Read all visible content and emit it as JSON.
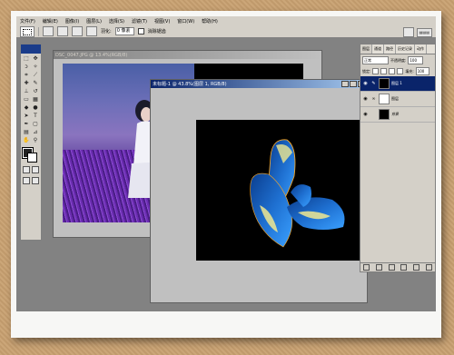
{
  "menubar": {
    "items": [
      "文件(F)",
      "编辑(E)",
      "图像(I)",
      "图层(L)",
      "选择(S)",
      "滤镜(T)",
      "视图(V)",
      "窗口(W)",
      "帮助(H)"
    ]
  },
  "options": {
    "feather_label": "羽化:",
    "feather_value": "0 像素",
    "antialias_label": "消除锯齿"
  },
  "doc1": {
    "title": "DSC_0047.JPG @ 13.4%(RGB/8)"
  },
  "doc2": {
    "title": "未标题-1 @ 43.8%(图层 1, RGB/8)"
  },
  "layers_panel": {
    "tabs": [
      "图层",
      "通道",
      "路径",
      "历史记录",
      "动作"
    ],
    "blend_mode": "正常",
    "opacity_label": "不透明度:",
    "opacity_value": "100",
    "lock_label": "锁定:",
    "fill_label": "填充:",
    "fill_value": "100",
    "layers": [
      {
        "name": "图层 1",
        "selected": true
      },
      {
        "name": "图层",
        "selected": false
      },
      {
        "name": "背景",
        "selected": false
      }
    ]
  },
  "colors": {
    "accent": "#0a246a",
    "canvas": "#000000",
    "wing_blue": "#1e6fd0",
    "wing_yellow": "#f0e890",
    "frame_bg": "#c8a070"
  }
}
